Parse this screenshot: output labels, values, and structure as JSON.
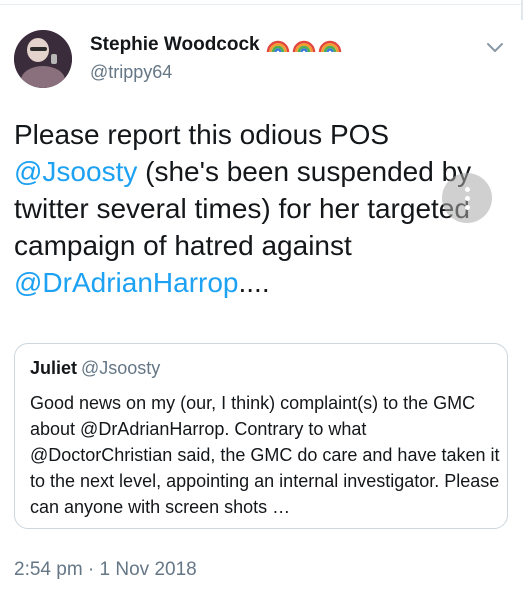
{
  "tweet": {
    "author": {
      "display_name": "Stephie Woodcock",
      "handle": "@trippy64",
      "emoji": [
        "rainbow-icon",
        "rainbow-icon",
        "rainbow-icon"
      ]
    },
    "text": {
      "part1": "Please report this odious POS ",
      "mention1": "@Jsoosty",
      "part2": " (she's been suspended by twitter several times) for her targeted campaign of hatred against ",
      "mention2": "@DrAdrianHarrop",
      "part3": "...."
    },
    "quoted": {
      "display_name": "Juliet",
      "handle": "@Jsoosty",
      "text": "Good news on my (our, I think) complaint(s) to the GMC about @DrAdrianHarrop. Contrary to what @DoctorChristian said, the GMC do care and have taken it to the next level, appointing an internal investigator. Please can anyone with screen shots …"
    },
    "timestamp": "2:54 pm · 1 Nov 2018"
  },
  "colors": {
    "link": "#1da1f2",
    "text": "#14171a",
    "secondary": "#657786",
    "border": "#ccd6dd"
  }
}
